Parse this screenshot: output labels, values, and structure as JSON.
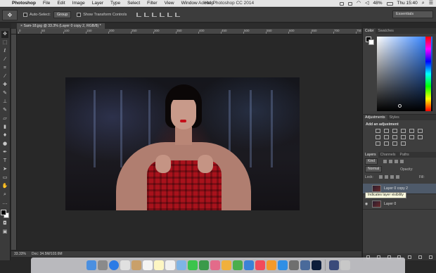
{
  "menubar": {
    "apple": "",
    "items": [
      {
        "label": "Photoshop",
        "bold": true
      },
      {
        "label": "File"
      },
      {
        "label": "Edit"
      },
      {
        "label": "Image"
      },
      {
        "label": "Layer"
      },
      {
        "label": "Type"
      },
      {
        "label": "Select"
      },
      {
        "label": "Filter"
      },
      {
        "label": "View"
      },
      {
        "label": "Window"
      },
      {
        "label": "Help"
      }
    ],
    "window_title": "Adobe Photoshop CC 2014",
    "battery": "48%",
    "clock": "Thu 15:40"
  },
  "options": {
    "auto_select_label": "Auto-Select:",
    "auto_select_value": "Group",
    "show_transform_label": "Show Transform Controls",
    "workspace": "Essentials"
  },
  "document": {
    "tab_title": "Sam-18.jpg @ 33.3% (Layer 0 copy 2, RGB/8) *",
    "ruler_h": [
      "0",
      "50",
      "100",
      "150",
      "200",
      "250",
      "300",
      "350",
      "400",
      "450",
      "500",
      "550",
      "600",
      "650",
      "700",
      "750"
    ],
    "zoom": "33.33%",
    "doc_info": "Doc: 34.5M/103.6M"
  },
  "panels": {
    "color_tabs": [
      "Color",
      "Swatches"
    ],
    "adjust_tabs": [
      "Adjustments",
      "Styles"
    ],
    "adjust_header": "Add an adjustment",
    "layers_tabs": [
      "Layers",
      "Channels",
      "Paths"
    ],
    "kind_filter": "Kind",
    "blend_mode": "Normal",
    "opacity_label": "Opacity:",
    "lock_label": "Lock:",
    "fill_label": "Fill:"
  },
  "layers": [
    {
      "name": "Layer 0 copy 2",
      "selected": true,
      "visible": false
    },
    {
      "name": "Layer 0",
      "selected": false,
      "visible": true
    }
  ],
  "tooltip": "Indicates layer visibility",
  "colors": {
    "accent": "#1a73ff",
    "lips": "#c4101a",
    "dress": "#a8121c"
  }
}
